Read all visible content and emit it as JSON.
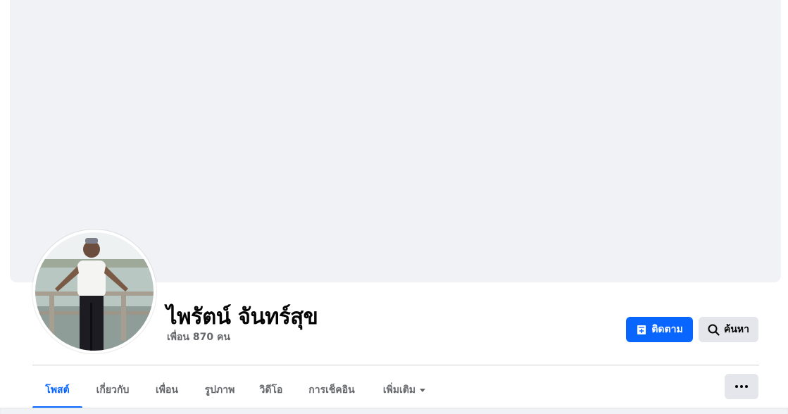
{
  "profile": {
    "name": "ไพรัตน์ จันทร์สุข",
    "friends": "เพื่อน 870 คน"
  },
  "actions": {
    "follow_label": "ติดตาม",
    "follow_icon": "follow-plus-icon",
    "search_label": "ค้นหา",
    "search_icon": "magnifier-icon",
    "more_icon": "ellipsis-icon"
  },
  "tabs": [
    {
      "label": "โพสต์",
      "active": true
    },
    {
      "label": "เกี่ยวกับ",
      "active": false
    },
    {
      "label": "เพื่อน",
      "active": false
    },
    {
      "label": "รูปภาพ",
      "active": false
    },
    {
      "label": "วิดีโอ",
      "active": false
    },
    {
      "label": "การเช็คอิน",
      "active": false
    },
    {
      "label": "เพิ่มเติม",
      "active": false,
      "dropdown": true
    }
  ],
  "colors": {
    "accent": "#0866ff",
    "cover": "#f0f2f5",
    "secondary_button": "#e4e6eb",
    "secondary_text": "#65676b"
  }
}
